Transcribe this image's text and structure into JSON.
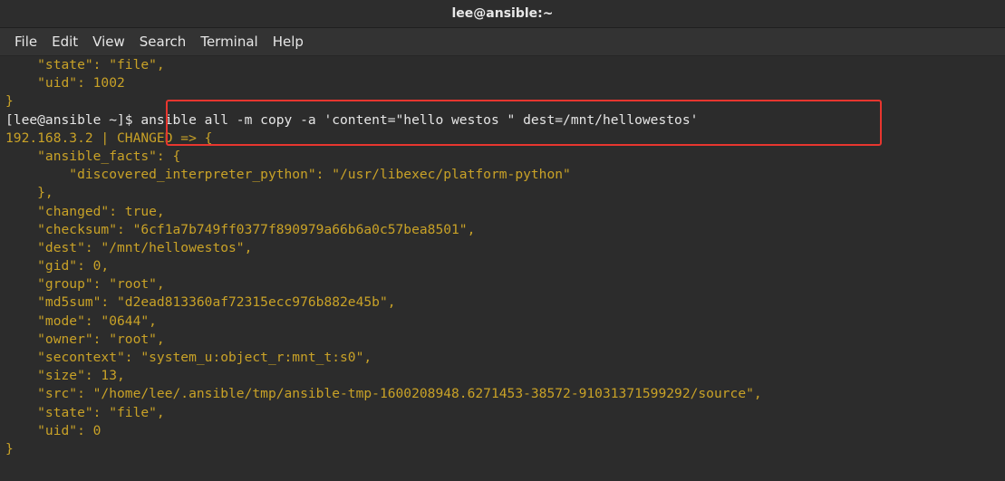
{
  "window": {
    "title": "lee@ansible:~"
  },
  "menu": [
    "File",
    "Edit",
    "View",
    "Search",
    "Terminal",
    "Help"
  ],
  "colors": {
    "output": "#c9a227",
    "prompt": "#e6e6e6",
    "highlight": "#e8362f"
  },
  "terminal": {
    "lines": [
      {
        "text": "    \"state\": \"file\",",
        "color": "y"
      },
      {
        "text": "    \"uid\": 1002",
        "color": "y"
      },
      {
        "text": "}",
        "color": "y"
      },
      {
        "text": "[lee@ansible ~]$ ansible all -m copy -a 'content=\"hello westos \" dest=/mnt/hellowestos'",
        "color": "w"
      },
      {
        "text": "192.168.3.2 | CHANGED => {",
        "color": "y"
      },
      {
        "text": "    \"ansible_facts\": {",
        "color": "y"
      },
      {
        "text": "        \"discovered_interpreter_python\": \"/usr/libexec/platform-python\"",
        "color": "y"
      },
      {
        "text": "    },",
        "color": "y"
      },
      {
        "text": "    \"changed\": true,",
        "color": "y"
      },
      {
        "text": "    \"checksum\": \"6cf1a7b749ff0377f890979a66b6a0c57bea8501\",",
        "color": "y"
      },
      {
        "text": "    \"dest\": \"/mnt/hellowestos\",",
        "color": "y"
      },
      {
        "text": "    \"gid\": 0,",
        "color": "y"
      },
      {
        "text": "    \"group\": \"root\",",
        "color": "y"
      },
      {
        "text": "    \"md5sum\": \"d2ead813360af72315ecc976b882e45b\",",
        "color": "y"
      },
      {
        "text": "    \"mode\": \"0644\",",
        "color": "y"
      },
      {
        "text": "    \"owner\": \"root\",",
        "color": "y"
      },
      {
        "text": "    \"secontext\": \"system_u:object_r:mnt_t:s0\",",
        "color": "y"
      },
      {
        "text": "    \"size\": 13,",
        "color": "y"
      },
      {
        "text": "    \"src\": \"/home/lee/.ansible/tmp/ansible-tmp-1600208948.6271453-38572-91031371599292/source\",",
        "color": "y"
      },
      {
        "text": "    \"state\": \"file\",",
        "color": "y"
      },
      {
        "text": "    \"uid\": 0",
        "color": "y"
      },
      {
        "text": "}",
        "color": "y"
      }
    ]
  }
}
